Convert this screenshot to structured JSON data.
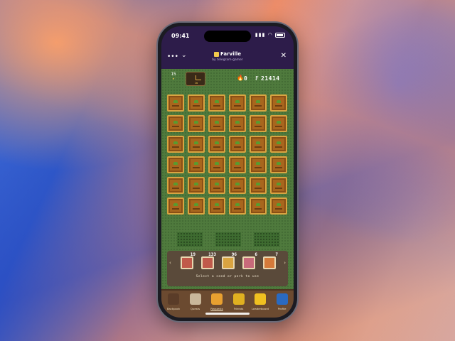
{
  "status_bar": {
    "time": "09:41"
  },
  "mini_app": {
    "title": "Farville",
    "subtitle": "by telegram-gamer"
  },
  "hud": {
    "level": "15",
    "clock_label": "1m",
    "streak": "0",
    "coin_symbol": "₣",
    "coins": "21414"
  },
  "inventory": {
    "items": [
      {
        "name": "seed-item-1",
        "count": "19",
        "color": "red"
      },
      {
        "name": "seed-item-2",
        "count": "133",
        "color": "red"
      },
      {
        "name": "seed-item-3",
        "count": "96",
        "color": "yellow"
      },
      {
        "name": "seed-item-4",
        "count": "6",
        "color": "pink"
      },
      {
        "name": "seed-item-5",
        "count": "7",
        "color": "orange"
      }
    ],
    "hint": "Select a seed or perk to use",
    "prev_arrow": "‹",
    "next_arrow": "›"
  },
  "nav": {
    "items": [
      {
        "label": "Backpack",
        "icon": "backpack-icon",
        "color": "#5a3c28"
      },
      {
        "label": "Quests",
        "icon": "scroll-icon",
        "color": "#c9b79a"
      },
      {
        "label": "Requests",
        "icon": "carrot-icon",
        "color": "#e8a030"
      },
      {
        "label": "Friends",
        "icon": "coin-icon",
        "color": "#e0b020"
      },
      {
        "label": "Leaderboard",
        "icon": "question-icon",
        "color": "#f0c020"
      },
      {
        "label": "Profile",
        "icon": "avatar-icon",
        "color": "#2a6ac0"
      }
    ]
  },
  "colors": {
    "grass": "#4f7a3d",
    "plot": "#a8661d",
    "plot_border": "#d9a441",
    "header": "#2d1c4a"
  }
}
